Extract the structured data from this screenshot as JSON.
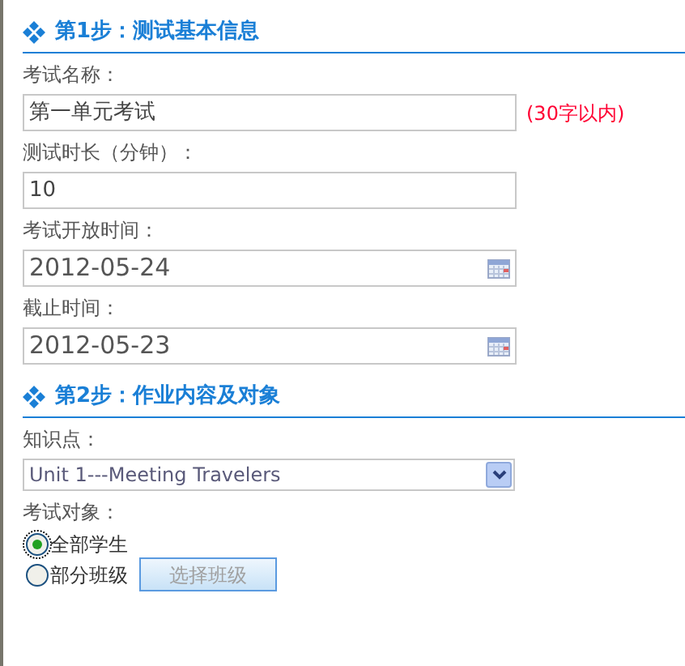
{
  "sections": [
    {
      "title": "第1步：测试基本信息",
      "fields": [
        {
          "kind": "text",
          "label": "考试名称：",
          "value": "第一单元考试",
          "note": "(30字以内)"
        },
        {
          "kind": "text",
          "label": "测试时长（分钟）：",
          "value": "10"
        },
        {
          "kind": "date",
          "label": "考试开放时间：",
          "value": "2012-05-24"
        },
        {
          "kind": "date",
          "label": "截止时间：",
          "value": "2012-05-23"
        }
      ]
    },
    {
      "title": "第2步：作业内容及对象",
      "fields": [
        {
          "kind": "select",
          "label": "知识点：",
          "value": "Unit 1---Meeting Travelers"
        },
        {
          "kind": "radios",
          "label": "考试对象：",
          "options": [
            {
              "label": "全部学生",
              "selected": true
            },
            {
              "label": "部分班级",
              "selected": false,
              "button": {
                "label": "选择班级",
                "disabled": true
              }
            }
          ]
        }
      ]
    }
  ]
}
